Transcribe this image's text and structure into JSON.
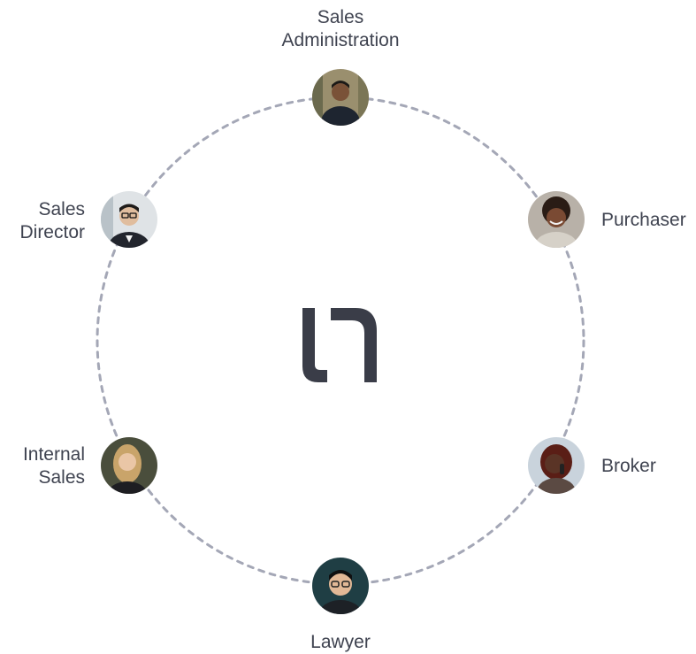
{
  "diagram": {
    "ring_color": "#a4a7b6",
    "logo_color": "#3a3d48",
    "nodes": [
      {
        "id": "sales-administration",
        "label_lines": [
          "Sales",
          "Administration"
        ],
        "avatar": {
          "bg": "#9a8f6e",
          "skin": "#7a5238",
          "hair": "#1c1a17",
          "shirt": "#1e2530"
        }
      },
      {
        "id": "purchaser",
        "label_lines": [
          "Purchaser"
        ],
        "avatar": {
          "bg": "#b8b1a8",
          "skin": "#7a4a33",
          "hair": "#2a1c15",
          "shirt": "#d6d1c8"
        }
      },
      {
        "id": "broker",
        "label_lines": [
          "Broker"
        ],
        "avatar": {
          "bg": "#c9d3dc",
          "skin": "#5a3426",
          "hair": "#5a1e16",
          "shirt": "#5b4a43"
        }
      },
      {
        "id": "lawyer",
        "label_lines": [
          "Lawyer"
        ],
        "avatar": {
          "bg": "#1f3e44",
          "skin": "#e2b896",
          "hair": "#0f0f10",
          "shirt": "#1d2126"
        }
      },
      {
        "id": "internal-sales",
        "label_lines": [
          "Internal",
          "Sales"
        ],
        "avatar": {
          "bg": "#4a4e3c",
          "skin": "#eac6a6",
          "hair": "#c9a46a",
          "shirt": "#1e1e22"
        }
      },
      {
        "id": "sales-director",
        "label_lines": [
          "Sales",
          "Director"
        ],
        "avatar": {
          "bg": "#dfe3e6",
          "skin": "#e0bd9e",
          "hair": "#1f1c1a",
          "shirt": "#22252d"
        }
      }
    ]
  }
}
